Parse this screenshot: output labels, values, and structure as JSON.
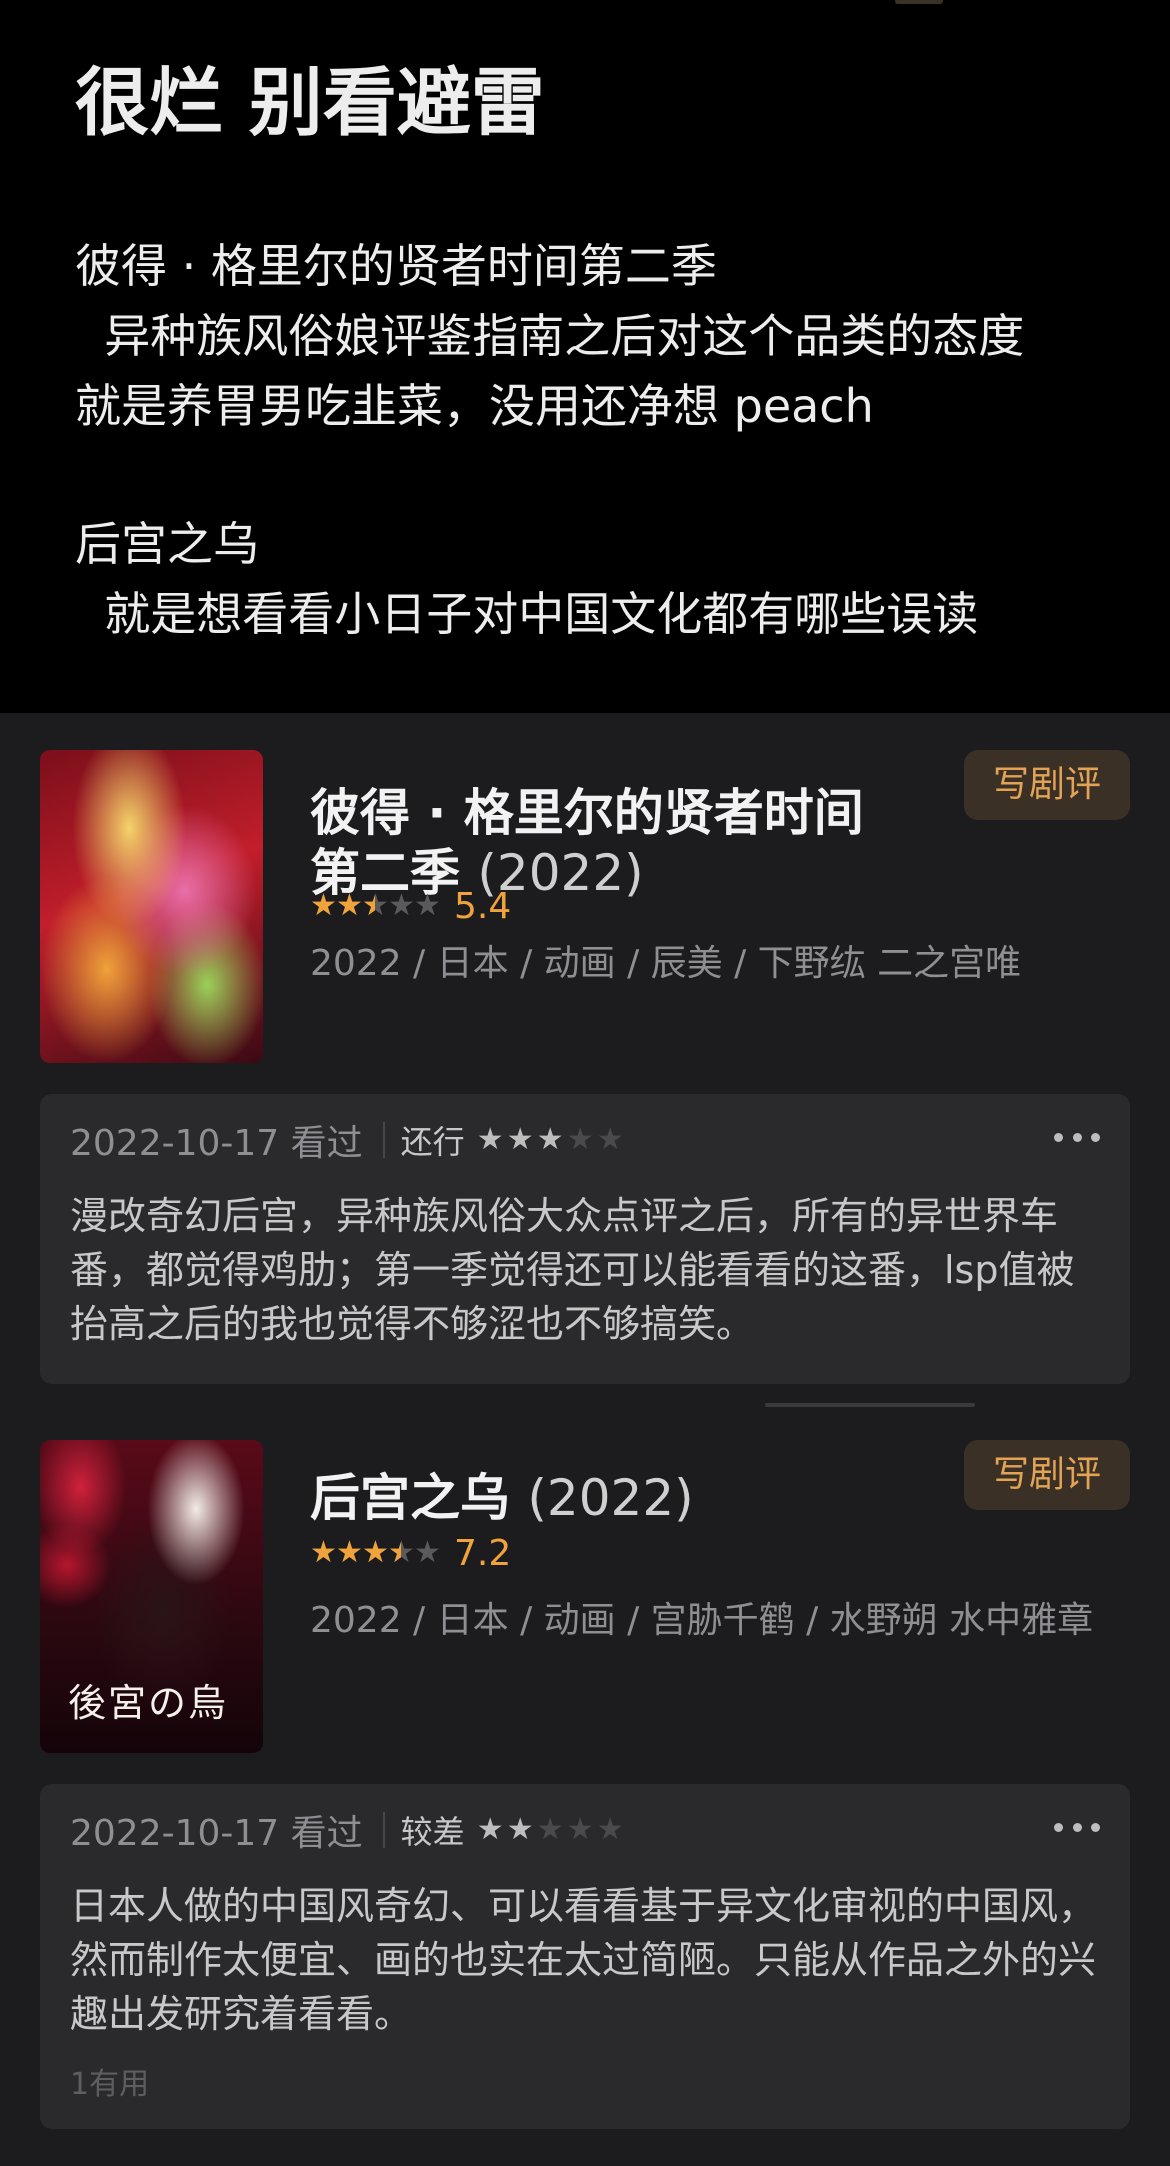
{
  "post": {
    "title": "很烂 别看避雷",
    "lines": [
      "彼得 · 格里尔的贤者时间第二季",
      "  异种族风俗娘评鉴指南之后对这个品类的态度",
      "就是养胃男吃韭菜，没用还净想 peach",
      "后宫之乌",
      "  就是想看看小日子对中国文化都有哪些误读"
    ]
  },
  "items": [
    {
      "title_lines": [
        "彼得 · 格里尔的贤者时间",
        "第二季"
      ],
      "year": "(2022)",
      "rating_stars": 2.5,
      "score": "5.4",
      "meta": "2022 / 日本 / 动画 / 辰美 / 下野纮 二之宫唯",
      "review_button": "写剧评",
      "poster_caption": "",
      "review": {
        "date": "2022-10-17 看过",
        "level": "还行",
        "stars": 3,
        "text": "漫改奇幻后宫，异种族风俗大众点评之后，所有的异世界车番，都觉得鸡肋；第一季觉得还可以能看看的这番，lsp值被抬高之后的我也觉得不够涩也不够搞笑。",
        "useful": ""
      }
    },
    {
      "title_lines": [
        "后宫之乌"
      ],
      "year": "(2022)",
      "rating_stars": 3.5,
      "score": "7.2",
      "meta": "2022 / 日本 / 动画 / 宫胁千鹤 / 水野朔 水中雅章",
      "review_button": "写剧评",
      "poster_caption": "後宮の烏",
      "review": {
        "date": "2022-10-17 看过",
        "level": "较差",
        "stars": 2,
        "text": "日本人做的中国风奇幻、可以看看基于异文化审视的中国风，然而制作太便宜、画的也实在太过简陋。只能从作品之外的兴趣出发研究着看看。",
        "useful": "1有用"
      }
    }
  ],
  "colors": {
    "accent": "#f0a23b",
    "button_bg": "#3a3026",
    "button_text": "#e3a355",
    "top_bg": "#000000",
    "list_bg": "#1c1c1e",
    "card_bg": "#2a2a2c"
  },
  "icons": [
    "star-icon",
    "more-icon"
  ]
}
